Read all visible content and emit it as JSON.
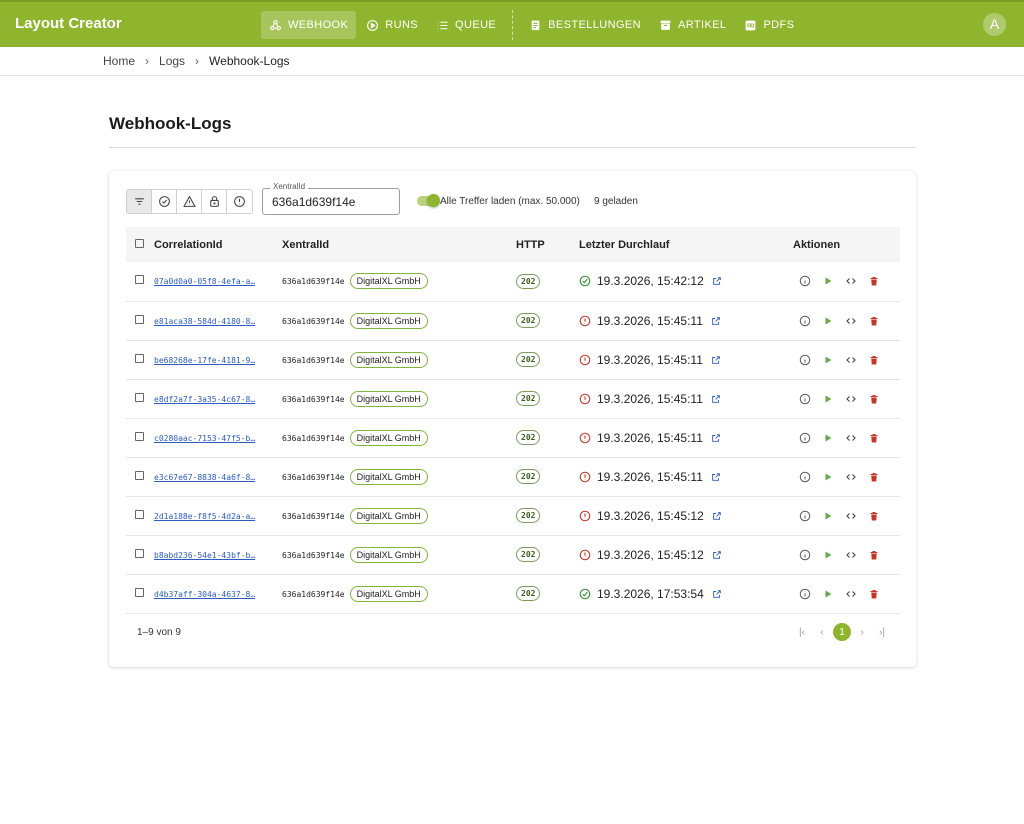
{
  "app": {
    "title": "Layout Creator",
    "avatar_letter": "A"
  },
  "nav": {
    "items": [
      {
        "label": "WEBHOOK",
        "icon": "webhook-icon",
        "active": true
      },
      {
        "label": "RUNS",
        "icon": "runs-icon",
        "active": false
      },
      {
        "label": "QUEUE",
        "icon": "queue-icon",
        "active": false
      },
      {
        "label": "BESTELLUNGEN",
        "icon": "receipt-icon",
        "active": false
      },
      {
        "label": "ARTIKEL",
        "icon": "archive-icon",
        "active": false
      },
      {
        "label": "PDFS",
        "icon": "pdf-icon",
        "active": false
      }
    ]
  },
  "breadcrumb": {
    "items": [
      "Home",
      "Logs",
      "Webhook-Logs"
    ]
  },
  "page": {
    "title": "Webhook-Logs"
  },
  "filters": {
    "icons": [
      "filter-all-icon",
      "check-circle-icon",
      "warning-icon",
      "lock-icon",
      "error-circle-icon"
    ],
    "xentral_label": "XentralId",
    "xentral_value": "636a1d639f14e",
    "load_all_label": "Alle Treffer laden (max. 50.000)",
    "load_all_on": true,
    "loaded_text": "9 geladen"
  },
  "table": {
    "headers": {
      "correlation": "CorrelationId",
      "xentral": "XentralId",
      "http": "HTTP",
      "last_run": "Letzter Durchlauf",
      "actions": "Aktionen"
    },
    "rows": [
      {
        "correlation": "07a0d0a0-05f8-4efa-a…",
        "xentral": "636a1d639f14e",
        "company": "DigitalXL GmbH",
        "http": "202",
        "status": "ok",
        "last_run": "19.3.2026, 15:42:12"
      },
      {
        "correlation": "e81aca38-584d-4180-8…",
        "xentral": "636a1d639f14e",
        "company": "DigitalXL GmbH",
        "http": "202",
        "status": "error",
        "last_run": "19.3.2026, 15:45:11"
      },
      {
        "correlation": "be68268e-17fe-4181-9…",
        "xentral": "636a1d639f14e",
        "company": "DigitalXL GmbH",
        "http": "202",
        "status": "error",
        "last_run": "19.3.2026, 15:45:11"
      },
      {
        "correlation": "e8df2a7f-3a35-4c67-8…",
        "xentral": "636a1d639f14e",
        "company": "DigitalXL GmbH",
        "http": "202",
        "status": "error",
        "last_run": "19.3.2026, 15:45:11"
      },
      {
        "correlation": "c0280aac-7153-47f5-b…",
        "xentral": "636a1d639f14e",
        "company": "DigitalXL GmbH",
        "http": "202",
        "status": "error",
        "last_run": "19.3.2026, 15:45:11"
      },
      {
        "correlation": "e3c67e67-8838-4a6f-8…",
        "xentral": "636a1d639f14e",
        "company": "DigitalXL GmbH",
        "http": "202",
        "status": "error",
        "last_run": "19.3.2026, 15:45:11"
      },
      {
        "correlation": "2d1a188e-f8f5-4d2a-a…",
        "xentral": "636a1d639f14e",
        "company": "DigitalXL GmbH",
        "http": "202",
        "status": "error",
        "last_run": "19.3.2026, 15:45:12"
      },
      {
        "correlation": "b8abd236-54e1-43bf-b…",
        "xentral": "636a1d639f14e",
        "company": "DigitalXL GmbH",
        "http": "202",
        "status": "error",
        "last_run": "19.3.2026, 15:45:12"
      },
      {
        "correlation": "d4b37aff-304a-4637-8…",
        "xentral": "636a1d639f14e",
        "company": "DigitalXL GmbH",
        "http": "202",
        "status": "ok",
        "last_run": "19.3.2026, 17:53:54"
      }
    ]
  },
  "pagination": {
    "range_text": "1–9 von 9",
    "current_page": "1"
  },
  "colors": {
    "brand": "#8fb52f",
    "ok": "#2e8b2e",
    "error": "#c0392b",
    "link": "#2c5bbf",
    "delete": "#c0392b",
    "play": "#6aa84f"
  }
}
